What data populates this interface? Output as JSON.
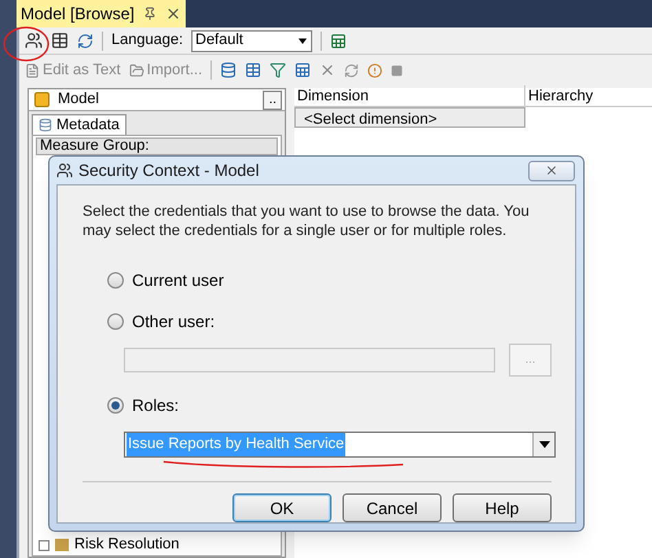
{
  "document_tab": {
    "title": "Model [Browse]"
  },
  "toolbar": {
    "language_label": "Language:",
    "language_value": "Default"
  },
  "edit_toolbar": {
    "buttons": [
      {
        "label": "Edit as Text",
        "disabled": true
      },
      {
        "label": "Import...",
        "disabled": true
      }
    ]
  },
  "left_panel": {
    "cube": "Model",
    "browse_button": "..",
    "tabs": [
      {
        "label": "Metadata",
        "selected": true
      }
    ],
    "group_label": "Measure Group:",
    "tree_items": [
      {
        "label": "Risk Resolution"
      }
    ]
  },
  "grid": {
    "columns": [
      "Dimension",
      "Hierarchy"
    ],
    "row": "<Select dimension>"
  },
  "dialog": {
    "title": "Security Context - Model",
    "message": "Select the credentials that you want to use to browse the data. You may select the credentials for a single user or for multiple roles.",
    "options": [
      {
        "kind": "current",
        "label": "Current user",
        "selected": false
      },
      {
        "kind": "other",
        "label": "Other user:",
        "selected": false
      },
      {
        "kind": "roles",
        "label": "Roles:",
        "selected": true
      }
    ],
    "browse_button": "...",
    "roles_value": "Issue Reports by Health Service",
    "buttons": [
      {
        "label": "OK",
        "default": true
      },
      {
        "label": "Cancel",
        "default": false
      },
      {
        "label": "Help",
        "default": false
      }
    ]
  }
}
